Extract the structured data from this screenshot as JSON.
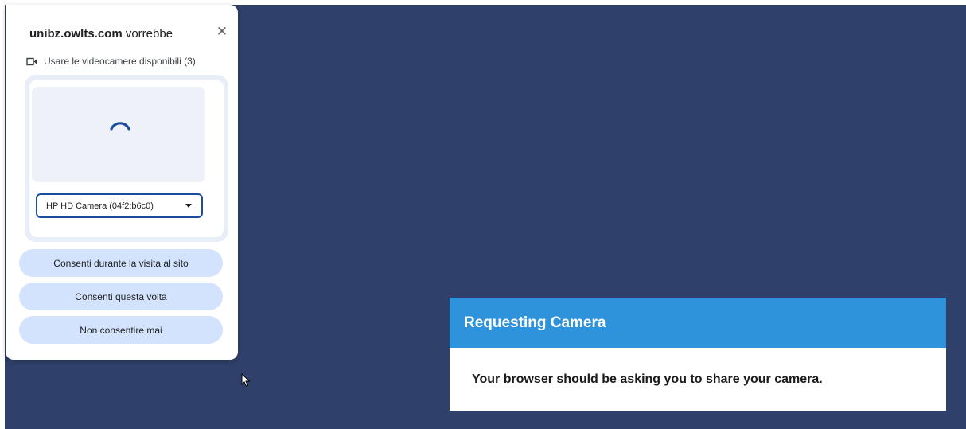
{
  "popup": {
    "site": "unibz.owlts.com",
    "request_verb": "vorrebbe",
    "close_symbol": "✕",
    "request_text": "Usare le videocamere disponibili (3)",
    "icon": "video-camera-icon",
    "camera_select": {
      "selected": "HP HD Camera (04f2:b6c0)"
    },
    "buttons": {
      "allow_while_visiting": "Consenti durante la visita al sito",
      "allow_this_time": "Consenti questa volta",
      "never_allow": "Non consentire mai"
    },
    "colors": {
      "button_bg": "#d3e3fd",
      "select_border": "#1a4e9c",
      "spinner": "#1a4e9c"
    }
  },
  "request_card": {
    "title": "Requesting Camera",
    "message": "Your browser should be asking you to share your camera.",
    "colors": {
      "header_bg": "#2f93db"
    }
  },
  "page": {
    "background": "#2f406a"
  }
}
